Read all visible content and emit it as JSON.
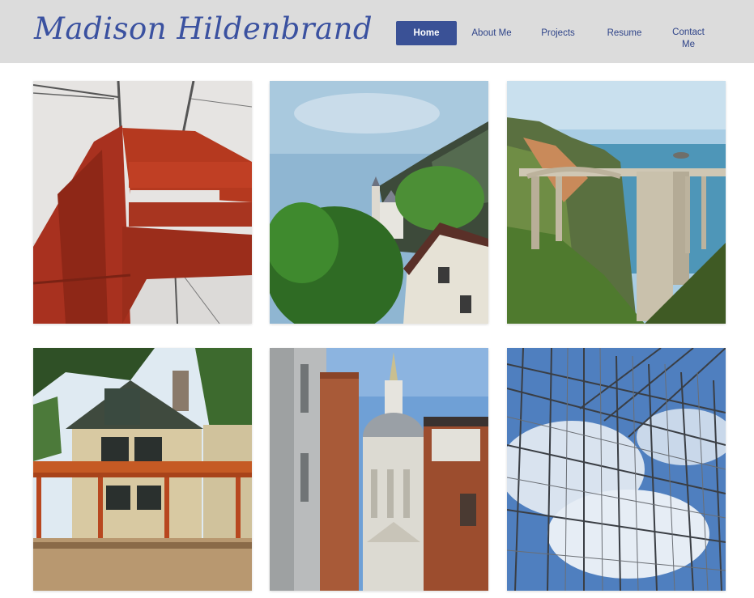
{
  "site": {
    "title": "Madison Hildenbrand"
  },
  "nav": {
    "items": [
      {
        "label": "Home",
        "active": true
      },
      {
        "label": "About Me",
        "active": false
      },
      {
        "label": "Projects",
        "active": false
      },
      {
        "label": "Resume",
        "active": false
      },
      {
        "label": "Contact Me",
        "active": false
      }
    ]
  },
  "colors": {
    "header_bg": "#dcdcdc",
    "brand": "#3a51a0",
    "nav_active_bg": "#3a5196"
  },
  "gallery": {
    "photos": [
      {
        "subject": "golden-gate-bridge-tower"
      },
      {
        "subject": "castle-among-trees"
      },
      {
        "subject": "coastal-arch-bridge"
      },
      {
        "subject": "wooden-house-under-construction"
      },
      {
        "subject": "cathedral-dome-between-buildings"
      },
      {
        "subject": "glass-roof-and-sky"
      }
    ]
  }
}
